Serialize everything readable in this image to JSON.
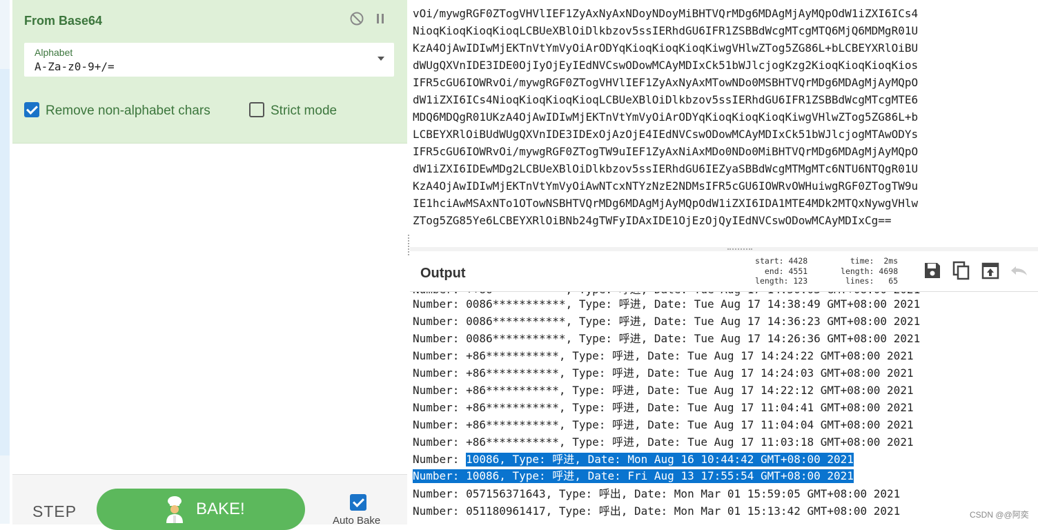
{
  "recipe": {
    "operation_title": "From Base64",
    "alphabet_label": "Alphabet",
    "alphabet_value": "A-Za-z0-9+/=",
    "remove_non_alphabet_label": "Remove non-alphabet chars",
    "remove_non_alphabet_checked": true,
    "strict_mode_label": "Strict mode",
    "strict_mode_checked": false,
    "disable_icon": "disable-icon",
    "pause_icon": "pause-icon"
  },
  "controls": {
    "step_label": "STEP",
    "bake_label": "BAKE!",
    "auto_bake_label": "Auto Bake",
    "auto_bake_checked": true
  },
  "input_lines": [
    "vOi/mywgRGF0ZTogVHVlIEF1ZyAxNyAxNDoyNDoyMiBHTVQrMDg6MDAgMjAyMQpOdW1iZXI6ICs4",
    "NioqKioqKioqKioqLCBUeXBlOiDlkbzov5ssIERhdGU6IFR1ZSBBdWcgMTcgMTQ6MjQ6MDMgR01U",
    "KzA4OjAwIDIwMjEKTnVtYmVyOiArODYqKioqKioqKioqKiwgVHlwZTog5ZG86L+bLCBEYXRlOiBU",
    "dWUgQXVnIDE3IDE0OjIyOjEyIEdNVCswODowMCAyMDIxCk51bWJlcjogKzg2KioqKioqKioqKios",
    "IFR5cGU6IOWRvOi/mywgRGF0ZTogVHVlIEF1ZyAxNyAxMTowNDo0MSBHTVQrMDg6MDAgMjAyMQpO",
    "dW1iZXI6ICs4NioqKioqKioqKioqLCBUeXBlOiDlkbzov5ssIERhdGU6IFR1ZSBBdWcgMTcgMTE6",
    "MDQ6MDQgR01UKzA4OjAwIDIwMjEKTnVtYmVyOiArODYqKioqKioqKioqKiwgVHlwZTog5ZG86L+b",
    "LCBEYXRlOiBUdWUgQXVnIDE3IDExOjAzOjE4IEdNVCswODowMCAyMDIxCk51bWJlcjogMTAwODYs",
    "IFR5cGU6IOWRvOi/mywgRGF0ZTogTW9uIEF1ZyAxNiAxMDo0NDo0MiBHTVQrMDg6MDAgMjAyMQpO",
    "dW1iZXI6IDEwMDg2LCBUeXBlOiDlkbzov5ssIERhdGU6IEZyaSBBdWcgMTMgMTc6NTU6NTQgR01U",
    "KzA4OjAwIDIwMjEKTnVtYmVyOiAwNTcxNTYzNzE2NDMsIFR5cGU6IOWRvOWHuiwgRGF0ZTogTW9u",
    "IE1hciAwMSAxNTo1OTowNSBHTVQrMDg6MDAgMjAyMQpOdW1iZXI6IDA1MTE4MDk2MTQxNywgVHlw",
    "ZTog5ZG85Ye6LCBEYXRlOiBNb24gTWFyIDAxIDE1OjEzOjQyIEdNVCswODowMCAyMDIxCg=="
  ],
  "output": {
    "title": "Output",
    "stats": {
      "start_label": "start:",
      "start": "4428",
      "end_label": "end:",
      "end": "4551",
      "sel_length_label": "length:",
      "sel_length": "123",
      "time_label": "time:",
      "time": "2ms",
      "length_label": "length:",
      "length": "4698",
      "lines_label": "lines:",
      "lines": "65"
    },
    "tools": [
      "save-icon",
      "copy-icon",
      "replace-input-icon",
      "undo-icon"
    ],
    "rows": [
      {
        "num": "0086***********",
        "type": "呼进",
        "date": "Tue Aug 17 14:38:49 GMT+08:00 2021",
        "highlight": false
      },
      {
        "num": "0086***********",
        "type": "呼进",
        "date": "Tue Aug 17 14:36:23 GMT+08:00 2021",
        "highlight": false
      },
      {
        "num": "0086***********",
        "type": "呼进",
        "date": "Tue Aug 17 14:26:36 GMT+08:00 2021",
        "highlight": false
      },
      {
        "num": "+86***********",
        "type": "呼进",
        "date": "Tue Aug 17 14:24:22 GMT+08:00 2021",
        "highlight": false
      },
      {
        "num": "+86***********",
        "type": "呼进",
        "date": "Tue Aug 17 14:24:03 GMT+08:00 2021",
        "highlight": false
      },
      {
        "num": "+86***********",
        "type": "呼进",
        "date": "Tue Aug 17 14:22:12 GMT+08:00 2021",
        "highlight": false
      },
      {
        "num": "+86***********",
        "type": "呼进",
        "date": "Tue Aug 17 11:04:41 GMT+08:00 2021",
        "highlight": false
      },
      {
        "num": "+86***********",
        "type": "呼进",
        "date": "Tue Aug 17 11:04:04 GMT+08:00 2021",
        "highlight": false
      },
      {
        "num": "+86***********",
        "type": "呼进",
        "date": "Tue Aug 17 11:03:18 GMT+08:00 2021",
        "highlight": false
      },
      {
        "num": "10086",
        "type": "呼进",
        "date": "Mon Aug 16 10:44:42 GMT+08:00 2021",
        "highlight": "partial"
      },
      {
        "num": "10086",
        "type": "呼进",
        "date": "Fri Aug 13 17:55:54 GMT+08:00 2021",
        "highlight": "full"
      },
      {
        "num": "057156371643",
        "type": "呼出",
        "date": "Mon Mar 01 15:59:05 GMT+08:00 2021",
        "highlight": false
      },
      {
        "num": "051180961417",
        "type": "呼出",
        "date": "Mon Mar 01 15:13:42 GMT+08:00 2021",
        "highlight": false
      }
    ],
    "row_prefix": "Number: ",
    "type_prefix": ", Type: ",
    "date_prefix": ", Date: "
  },
  "watermark": "CSDN @@阿奕",
  "colors": {
    "recipe_bg": "#dff0d8",
    "recipe_text": "#3c763d",
    "bake_green": "#5cb85c",
    "accent_blue": "#1a73c8",
    "highlight_blue": "#0a74cf"
  }
}
